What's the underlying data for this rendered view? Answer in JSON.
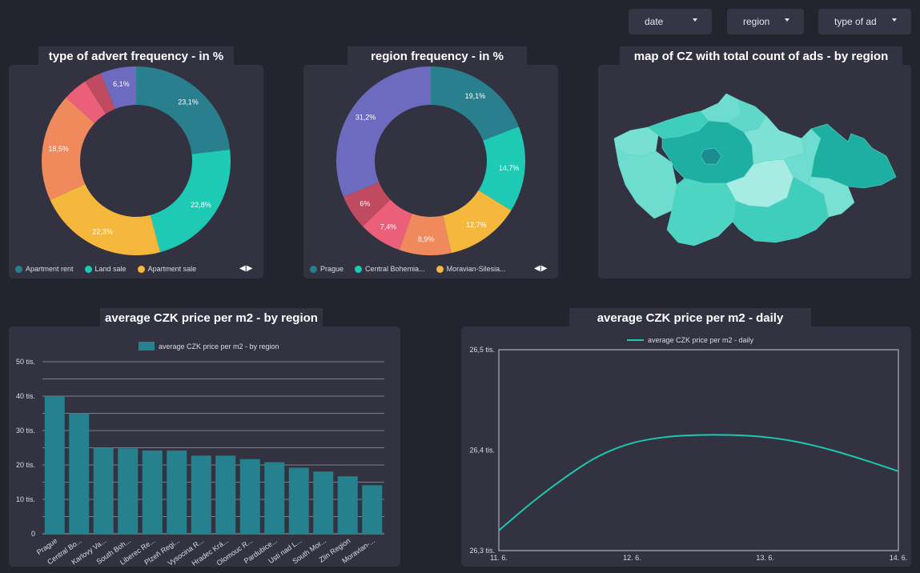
{
  "filters": [
    {
      "label": "date"
    },
    {
      "label": "region"
    },
    {
      "label": "type of ad"
    }
  ],
  "cards": {
    "advert_type": {
      "title": "type of advert frequency - in %"
    },
    "region": {
      "title": "region frequency - in %"
    },
    "map": {
      "title": "map of CZ with total count of ads -  by region"
    },
    "price_region": {
      "title": "average CZK price per m2 - by region"
    },
    "price_daily": {
      "title": "average CZK price per m2 - daily"
    }
  },
  "legends": {
    "advert_type": [
      "Apartment rent",
      "Land sale",
      "Apartment sale"
    ],
    "region": [
      "Prague",
      "Central Bohemia...",
      "Moravian-Silesia..."
    ]
  },
  "pager": {
    "prev": "◀",
    "next": "▶"
  },
  "colors": {
    "teal_dark": "#2a7f8f",
    "teal": "#1fcab5",
    "yellow": "#f5b83d",
    "orange": "#f08a5d",
    "pink": "#ec5f7b",
    "crimson": "#c04a5f",
    "purple": "#6c6bbf",
    "bar": "#26818f",
    "line": "#1dc7b2"
  },
  "chart_data": [
    {
      "type": "pie",
      "title": "type of advert frequency - in %",
      "donut": true,
      "labels": [
        "Apartment rent",
        "Land sale",
        "Apartment sale",
        "",
        "",
        "",
        ""
      ],
      "values": [
        23.1,
        22.8,
        22.3,
        18.5,
        4.2,
        3.0,
        6.1
      ],
      "value_labels": [
        "23,1%",
        "22,8%",
        "22,3%",
        "18,5%",
        "",
        "",
        "6,1%"
      ],
      "colors": [
        "#2a7f8f",
        "#1fcab5",
        "#f5b83d",
        "#f08a5d",
        "#ec5f7b",
        "#c04a5f",
        "#6c6bbf"
      ],
      "legend_position": "bottom"
    },
    {
      "type": "pie",
      "title": "region frequency - in %",
      "donut": true,
      "labels": [
        "Prague",
        "Central Bohemia...",
        "Moravian-Silesia...",
        "",
        "",
        "",
        ""
      ],
      "values": [
        19.1,
        14.7,
        12.7,
        8.9,
        7.4,
        6.0,
        31.2
      ],
      "value_labels": [
        "19,1%",
        "14,7%",
        "12,7%",
        "8,9%",
        "7,4%",
        "6%",
        "31,2%"
      ],
      "colors": [
        "#2a7f8f",
        "#1fcab5",
        "#f5b83d",
        "#f08a5d",
        "#ec5f7b",
        "#c04a5f",
        "#6c6bbf"
      ],
      "legend_position": "bottom"
    },
    {
      "type": "bar",
      "title": "average CZK price per m2 - by region",
      "series": [
        {
          "name": "average CZK price per m2 - by region",
          "values": [
            40000,
            35000,
            25000,
            24800,
            24200,
            24200,
            22700,
            22700,
            21700,
            20800,
            19200,
            18100,
            16700,
            14100
          ]
        }
      ],
      "categories": [
        "Prague",
        "Central Bo...",
        "Karlovy Va...",
        "South Boh...",
        "Liberec Re...",
        "Plzeň Regi...",
        "Vysocina R...",
        "Hradec Krá...",
        "Olomouc R...",
        "Pardubice...",
        "Usti nad L...",
        "South Mor...",
        "Zlin Region",
        "Moravian-..."
      ],
      "yticks": [
        {
          "v": 0,
          "label": "0"
        },
        {
          "v": 10000,
          "label": "10 tis."
        },
        {
          "v": 20000,
          "label": "20 tis."
        },
        {
          "v": 30000,
          "label": "30 tis."
        },
        {
          "v": 40000,
          "label": "40 tis."
        },
        {
          "v": 50000,
          "label": "50 tis."
        }
      ],
      "ylim": [
        0,
        50000
      ],
      "grid": true,
      "legend_position": "top"
    },
    {
      "type": "line",
      "title": "average CZK price per m2 - daily",
      "series": [
        {
          "name": "average CZK price per m2 - daily",
          "x": [
            0,
            0.25,
            0.5,
            0.75,
            1,
            1.25,
            1.5,
            1.75,
            2,
            2.25,
            2.5,
            2.75,
            3
          ],
          "y": [
            26320,
            26348,
            26373,
            26394,
            26407,
            26413,
            26415,
            26415,
            26413,
            26408,
            26400,
            26390,
            26379
          ]
        }
      ],
      "xticks": [
        {
          "v": 0,
          "label": "11. 6."
        },
        {
          "v": 1,
          "label": "12. 6."
        },
        {
          "v": 2,
          "label": "13. 6."
        },
        {
          "v": 3,
          "label": "14. 6."
        }
      ],
      "yticks": [
        {
          "v": 26300,
          "label": "26,3 tis."
        },
        {
          "v": 26400,
          "label": "26,4 tis."
        },
        {
          "v": 26500,
          "label": "26,5 tis."
        }
      ],
      "ylim": [
        26300,
        26500
      ],
      "xlim": [
        0,
        3
      ],
      "legend_position": "top"
    }
  ]
}
